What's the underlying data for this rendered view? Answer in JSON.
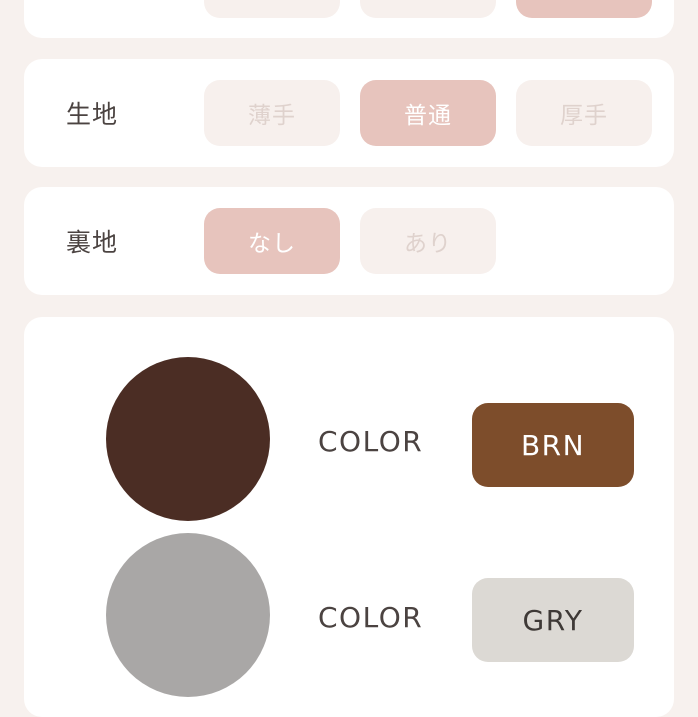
{
  "fabric": {
    "label": "生地",
    "options": [
      "薄手",
      "普通",
      "厚手"
    ],
    "selected": "普通"
  },
  "lining": {
    "label": "裏地",
    "options": [
      "なし",
      "あり"
    ],
    "selected": "なし"
  },
  "colors": [
    {
      "label": "COLOR",
      "code": "BRN",
      "swatch_color": "#4b2d24",
      "badge_color": "#7d4d2b",
      "badge_text_color": "#ffffff"
    },
    {
      "label": "COLOR",
      "code": "GRY",
      "swatch_color": "#a9a7a6",
      "badge_color": "#dcd9d4",
      "badge_text_color": "#3e3936"
    }
  ],
  "theme": {
    "background": "#f7f1ee",
    "pill_active": "#e7c4bd",
    "pill_inactive": "#f7f0ed"
  }
}
